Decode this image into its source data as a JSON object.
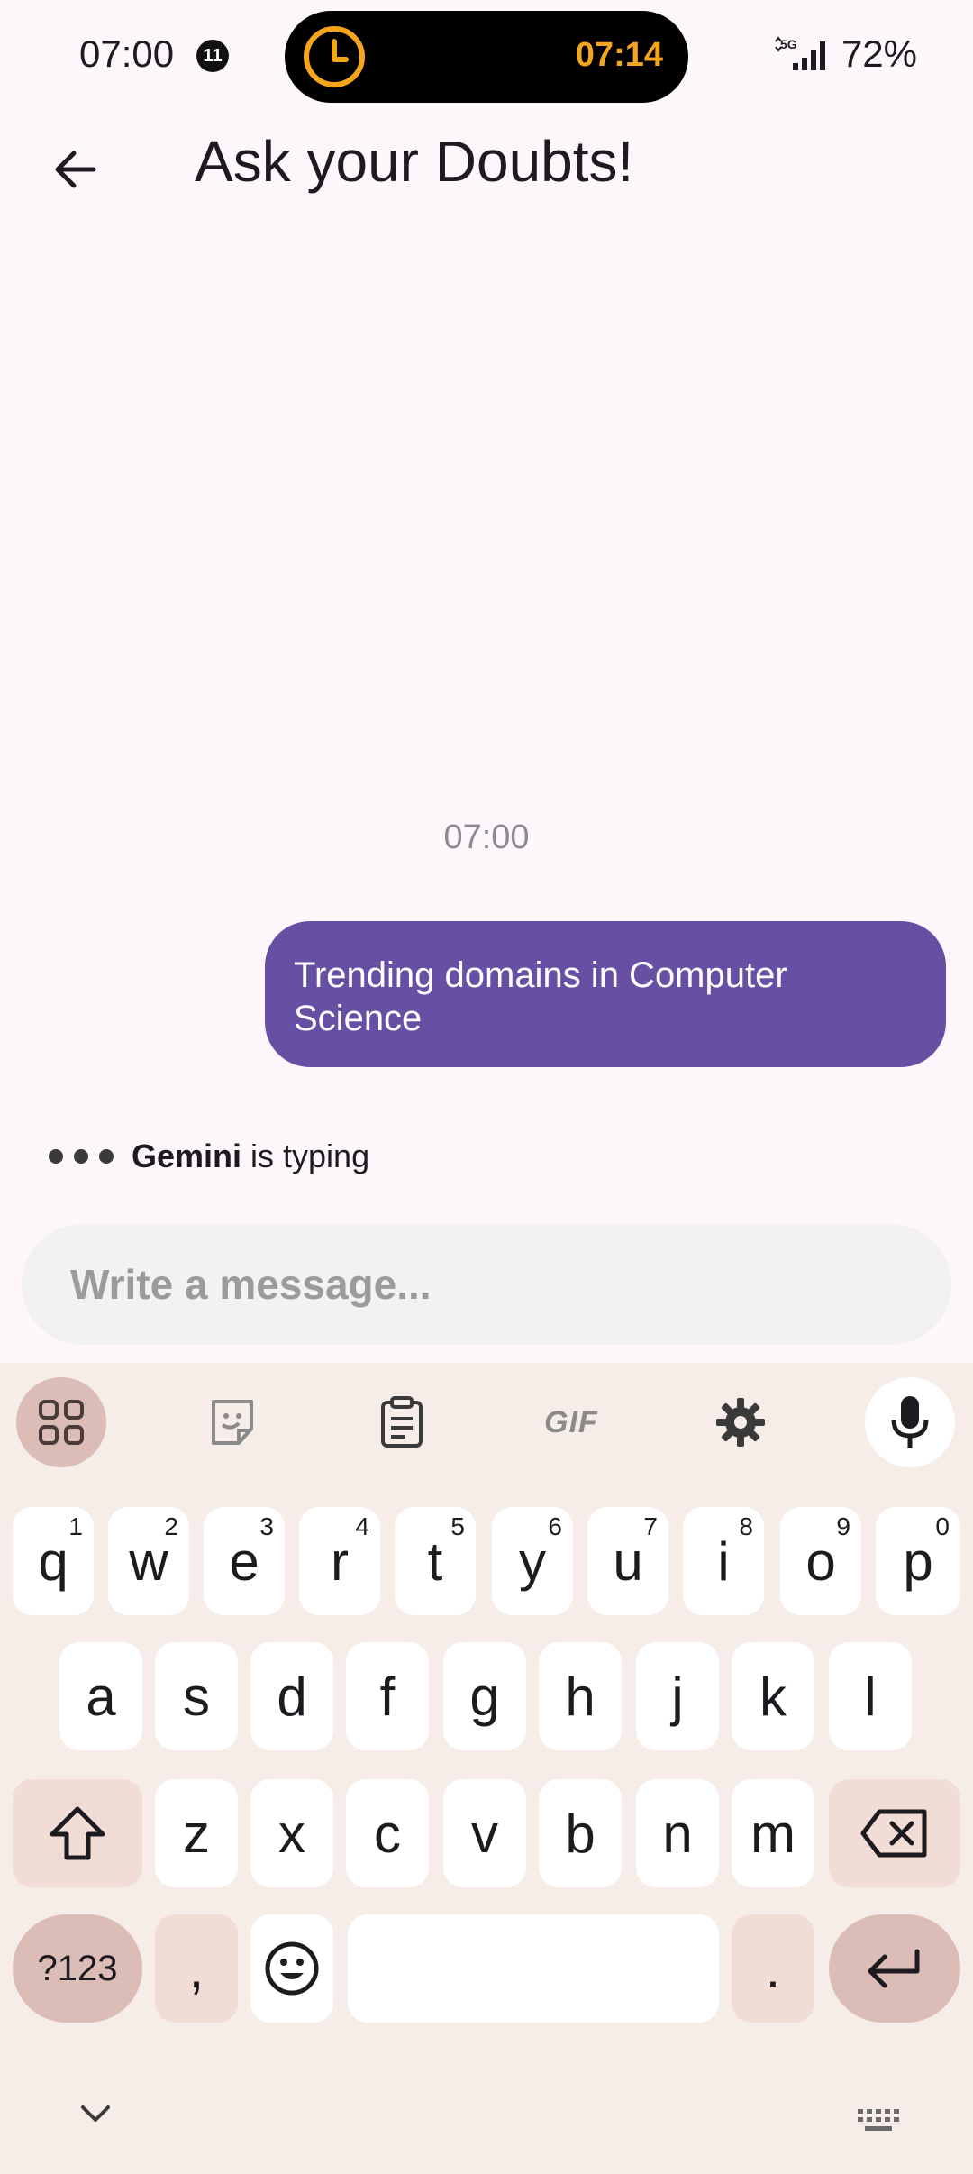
{
  "status": {
    "time": "07:00",
    "notification_count": "11",
    "timer": "07:14",
    "network": "5G",
    "battery": "72%"
  },
  "header": {
    "title": "Ask your Doubts!"
  },
  "chat": {
    "timestamp": "07:00",
    "user_message": "Trending domains in Computer Science",
    "typing_name": "Gemini",
    "typing_suffix": "is typing"
  },
  "composer": {
    "placeholder": "Write a message..."
  },
  "keyboard": {
    "toolbar": [
      "apps-icon",
      "sticker-icon",
      "clipboard-icon",
      "GIF",
      "gear-icon",
      "mic-icon"
    ],
    "row1": [
      [
        "q",
        "1"
      ],
      [
        "w",
        "2"
      ],
      [
        "e",
        "3"
      ],
      [
        "r",
        "4"
      ],
      [
        "t",
        "5"
      ],
      [
        "y",
        "6"
      ],
      [
        "u",
        "7"
      ],
      [
        "i",
        "8"
      ],
      [
        "o",
        "9"
      ],
      [
        "p",
        "0"
      ]
    ],
    "row2": [
      "a",
      "s",
      "d",
      "f",
      "g",
      "h",
      "j",
      "k",
      "l"
    ],
    "row3": [
      "z",
      "x",
      "c",
      "v",
      "b",
      "n",
      "m"
    ],
    "symbols": "?123",
    "comma": ",",
    "period": ".",
    "accent_color": "#6750a4"
  }
}
